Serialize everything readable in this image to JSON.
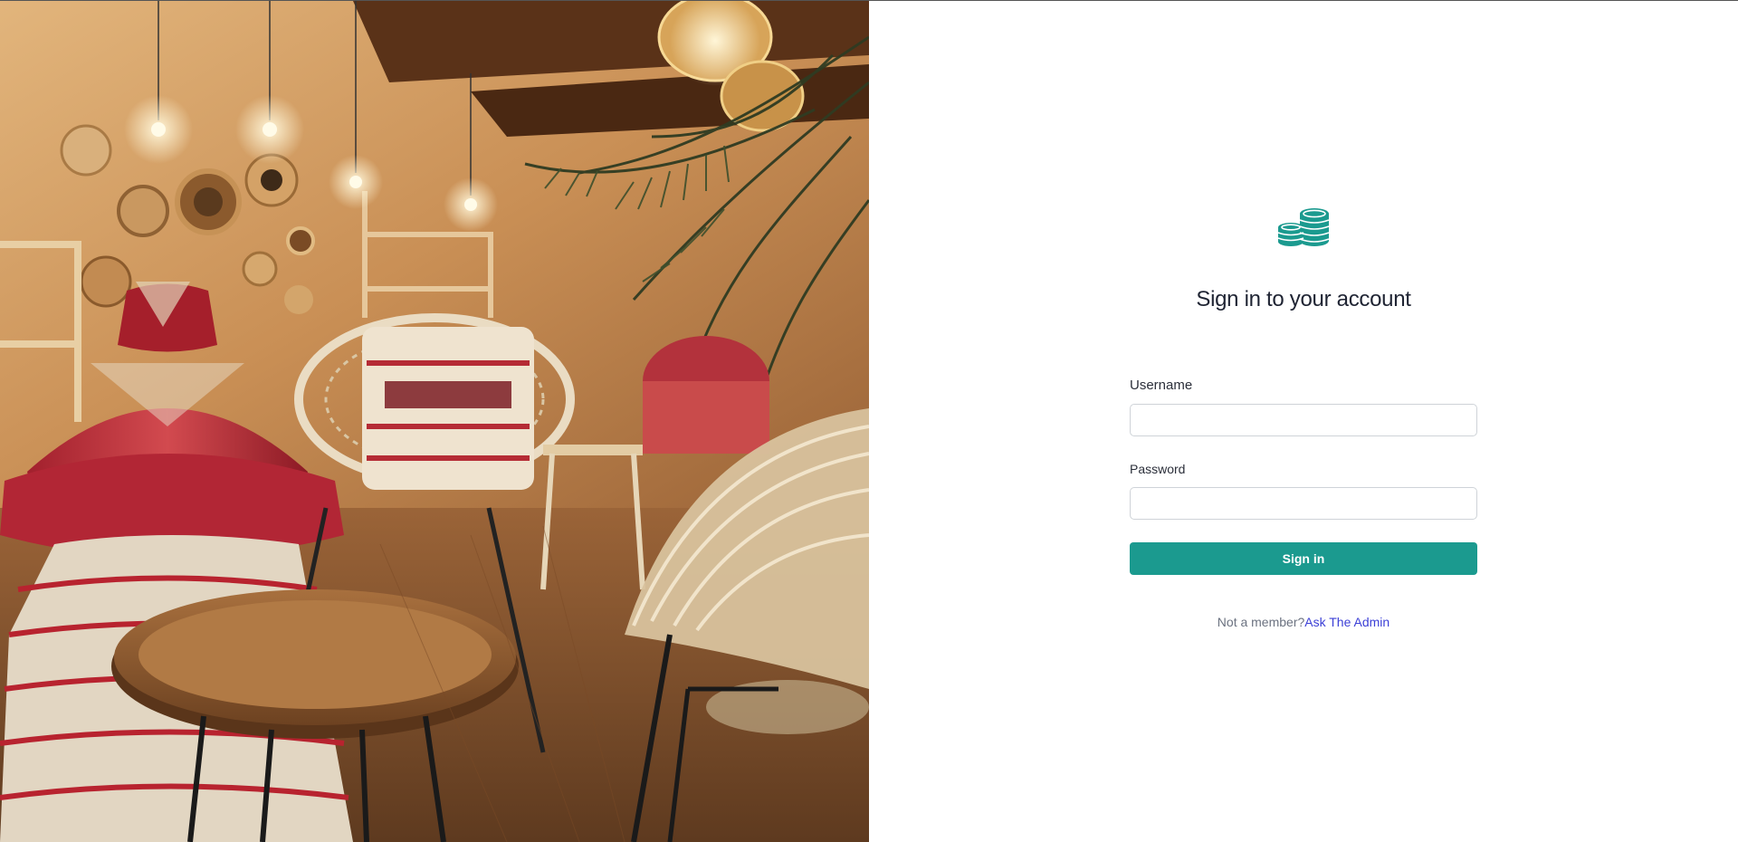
{
  "hero_image": {
    "description_icon": "cafe-interior-photo"
  },
  "brand": {
    "logo_icon": "coins-stack-icon",
    "accent_color": "#1b9a8f"
  },
  "form": {
    "title": "Sign in to your account",
    "username_label": "Username",
    "username_value": "",
    "password_label": "Password",
    "password_value": "",
    "submit_label": "Sign in"
  },
  "footer": {
    "prompt_text": "Not a member?",
    "link_text": "Ask The Admin",
    "link_color": "#3b3fd6"
  }
}
